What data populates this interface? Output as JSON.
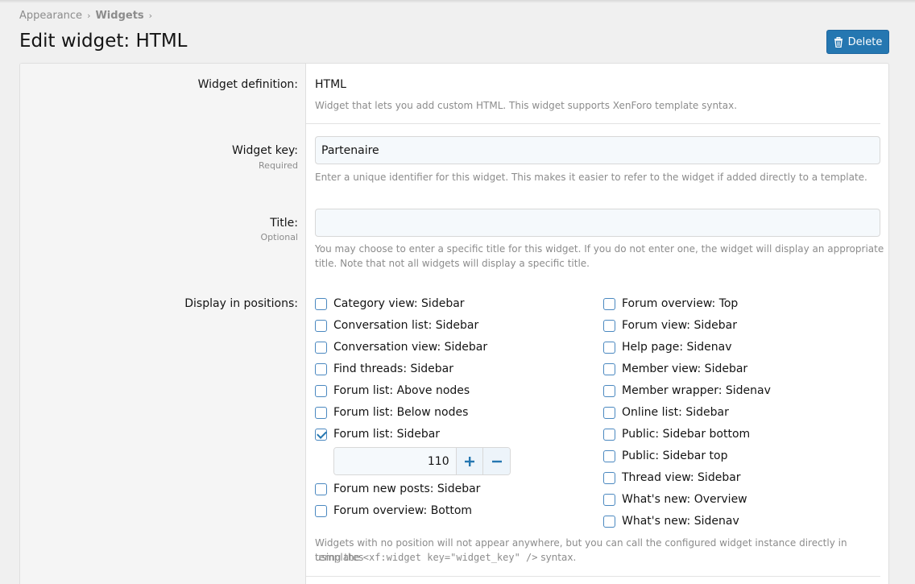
{
  "breadcrumb": {
    "items": [
      "Appearance",
      "Widgets"
    ],
    "separator": "›"
  },
  "page_title": "Edit widget: HTML",
  "delete_button": {
    "label": "Delete",
    "icon": "trash-icon"
  },
  "form": {
    "widget_definition": {
      "label": "Widget definition:",
      "value": "HTML",
      "explain": "Widget that lets you add custom HTML. This widget supports XenForo template syntax."
    },
    "widget_key": {
      "label": "Widget key:",
      "hint": "Required",
      "value": "Partenaire",
      "explain": "Enter a unique identifier for this widget. This makes it easier to refer to the widget if added directly to a template."
    },
    "title": {
      "label": "Title:",
      "hint": "Optional",
      "value": "",
      "explain_line1": "You may choose to enter a specific title for this widget. If you do not enter one, the widget will display an appropriate",
      "explain_line2": "title. Note that not all widgets will display a specific title."
    },
    "positions": {
      "label": "Display in positions:",
      "left": [
        {
          "label": "Category view: Sidebar",
          "checked": false
        },
        {
          "label": "Conversation list: Sidebar",
          "checked": false
        },
        {
          "label": "Conversation view: Sidebar",
          "checked": false
        },
        {
          "label": "Find threads: Sidebar",
          "checked": false
        },
        {
          "label": "Forum list: Above nodes",
          "checked": false
        },
        {
          "label": "Forum list: Below nodes",
          "checked": false
        },
        {
          "label": "Forum list: Sidebar",
          "checked": true
        },
        {
          "label": "Forum new posts: Sidebar",
          "checked": false
        },
        {
          "label": "Forum overview: Bottom",
          "checked": false
        }
      ],
      "right": [
        {
          "label": "Forum overview: Top",
          "checked": false
        },
        {
          "label": "Forum view: Sidebar",
          "checked": false
        },
        {
          "label": "Help page: Sidenav",
          "checked": false
        },
        {
          "label": "Member view: Sidebar",
          "checked": false
        },
        {
          "label": "Member wrapper: Sidenav",
          "checked": false
        },
        {
          "label": "Online list: Sidebar",
          "checked": false
        },
        {
          "label": "Public: Sidebar bottom",
          "checked": false
        },
        {
          "label": "Public: Sidebar top",
          "checked": false
        },
        {
          "label": "Thread view: Sidebar",
          "checked": false
        },
        {
          "label": "What's new: Overview",
          "checked": false
        },
        {
          "label": "What's new: Sidenav",
          "checked": false
        }
      ],
      "order_value": "110",
      "explain_line1": "Widgets with no position will not appear anywhere, but you can call the configured widget instance directly in templates",
      "explain_line2_prefix": "using the",
      "explain_code": "<xf:widget key=\"widget_key\" />",
      "explain_line2_suffix": "syntax."
    }
  }
}
